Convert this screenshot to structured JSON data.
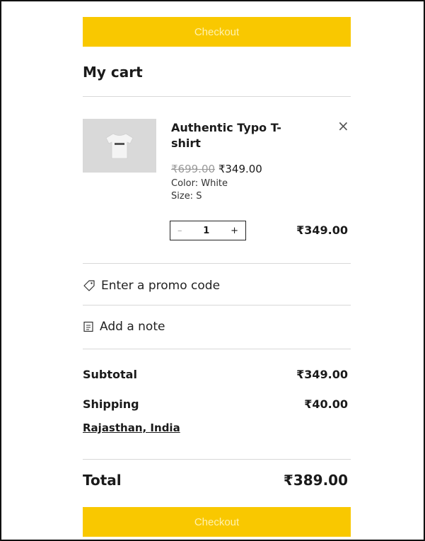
{
  "checkout_label": "Checkout",
  "cart_title": "My cart",
  "item": {
    "name": "Authentic Typo T-shirt",
    "original_price": "₹699.00",
    "price": "₹349.00",
    "color": "Color: White",
    "size": "Size: S",
    "quantity": "1",
    "qty_minus": "–",
    "qty_plus": "+",
    "line_total": "₹349.00",
    "remove_glyph": "×",
    "image_icon": "tshirt-icon"
  },
  "promo": {
    "label": "Enter a promo code",
    "icon": "tag-icon"
  },
  "note": {
    "label": "Add a note",
    "icon": "note-icon"
  },
  "summary": {
    "subtotal_label": "Subtotal",
    "subtotal_value": "₹349.00",
    "shipping_label": "Shipping",
    "shipping_value": "₹40.00",
    "location": "Rajasthan, India"
  },
  "total": {
    "label": "Total",
    "value": "₹389.00"
  },
  "colors": {
    "accent": "#f9c800",
    "checkout_text": "#fff2b0"
  }
}
